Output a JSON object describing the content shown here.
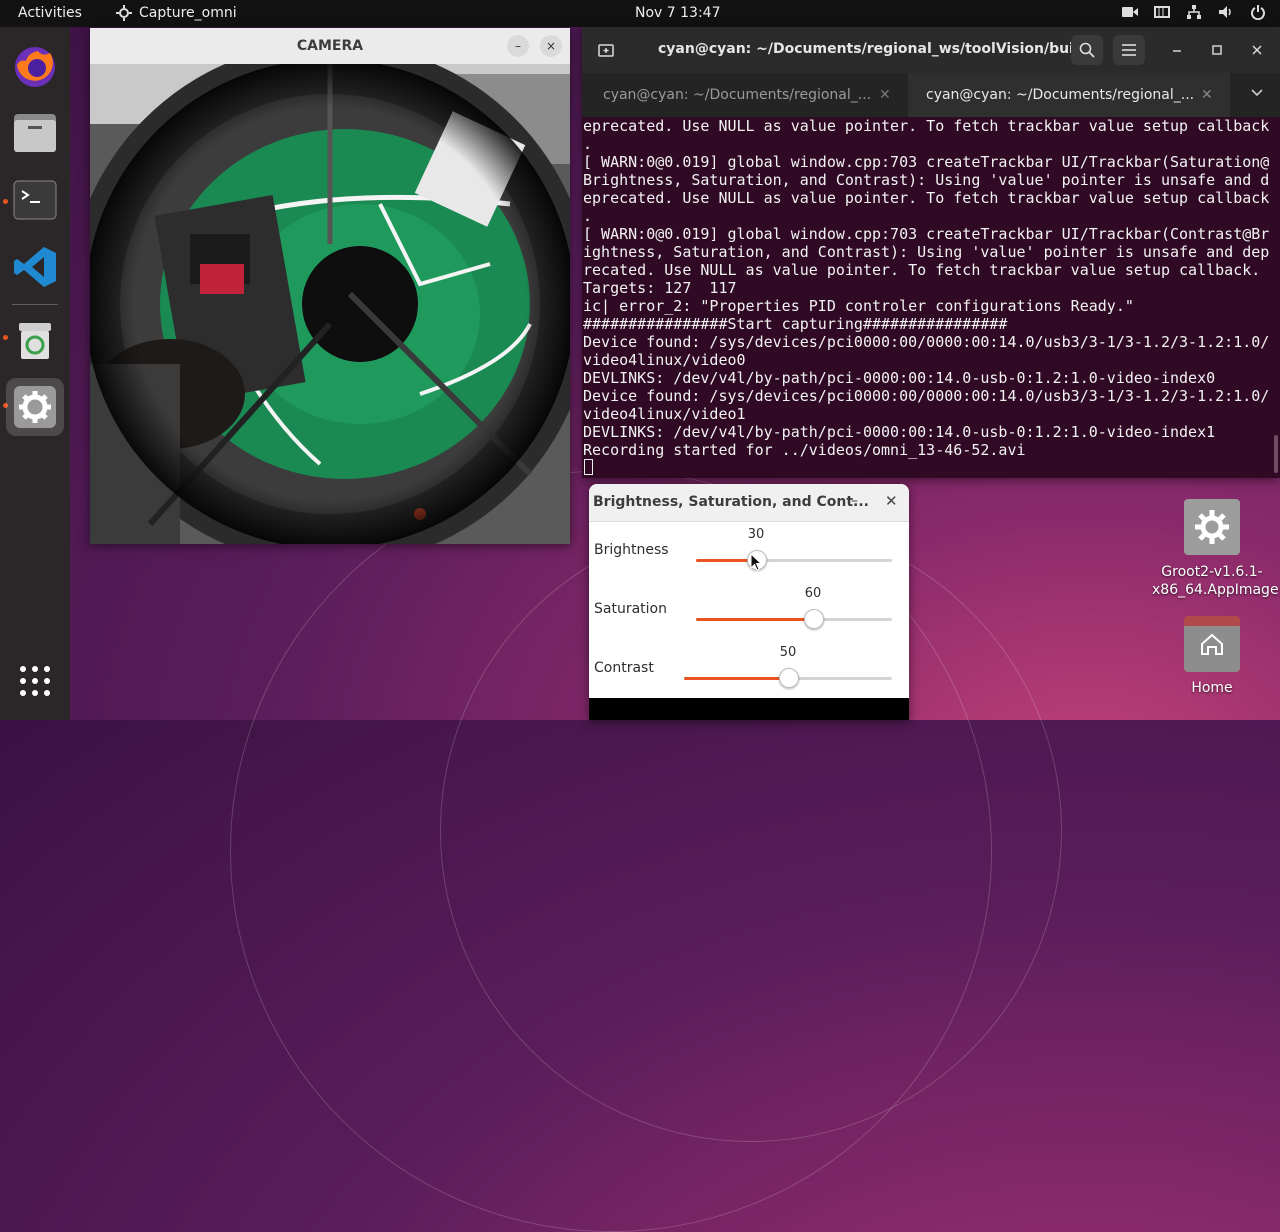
{
  "topbar": {
    "activities": "Activities",
    "app_name": "Capture_omni",
    "clock": "Nov 7  13:47"
  },
  "camera_window": {
    "title": "CAMERA",
    "minimize_label": "–",
    "close_label": "×"
  },
  "terminal": {
    "title": "cyan@cyan: ~/Documents/regional_ws/toolVision/build",
    "tabs": [
      {
        "label": "cyan@cyan: ~/Documents/regional_...",
        "active": false
      },
      {
        "label": "cyan@cyan: ~/Documents/regional_...",
        "active": true
      }
    ],
    "lines": [
      "eprecated. Use NULL as value pointer. To fetch trackbar value setup callback",
      ".",
      "[ WARN:0@0.019] global window.cpp:703 createTrackbar UI/Trackbar(Saturation@",
      "Brightness, Saturation, and Contrast): Using 'value' pointer is unsafe and d",
      "eprecated. Use NULL as value pointer. To fetch trackbar value setup callback",
      ".",
      "[ WARN:0@0.019] global window.cpp:703 createTrackbar UI/Trackbar(Contrast@Br",
      "ightness, Saturation, and Contrast): Using 'value' pointer is unsafe and dep",
      "recated. Use NULL as value pointer. To fetch trackbar value setup callback.",
      "Targets: 127  117",
      "ic| error_2: \"Properties PID controler configurations Ready.\"",
      "################Start capturing################",
      "Device found: /sys/devices/pci0000:00/0000:00:14.0/usb3/3-1/3-1.2/3-1.2:1.0/",
      "video4linux/video0",
      "DEVLINKS: /dev/v4l/by-path/pci-0000:00:14.0-usb-0:1.2:1.0-video-index0",
      "Device found: /sys/devices/pci0000:00/0000:00:14.0/usb3/3-1/3-1.2/3-1.2:1.0/",
      "video4linux/video1",
      "DEVLINKS: /dev/v4l/by-path/pci-0000:00:14.0-usb-0:1.2:1.0-video-index1",
      "Recording started for ../videos/omni_13-46-52.avi"
    ]
  },
  "trackbars": {
    "title": "Brightness, Saturation, and Cont...",
    "items": [
      {
        "label": "Brightness",
        "value": "30",
        "fraction": 0.3
      },
      {
        "label": "Saturation",
        "value": "60",
        "fraction": 0.6
      },
      {
        "label": "Contrast",
        "value": "50",
        "fraction": 0.5
      }
    ]
  },
  "desktop_icons": [
    {
      "label": "Groot2-v1.6.1-\nx86_64.AppImage",
      "icon": "gear-icon"
    },
    {
      "label": "Home",
      "icon": "home-folder-icon"
    }
  ],
  "colors": {
    "accent": "#e95420",
    "terminal_bg": "#300a24",
    "dock_bg": "#2b2729"
  }
}
